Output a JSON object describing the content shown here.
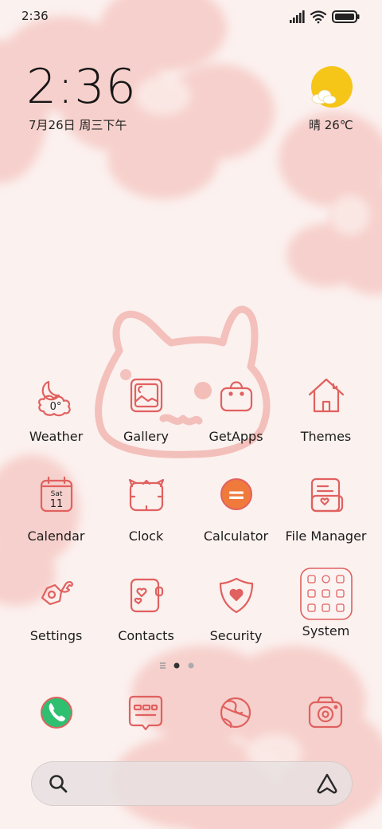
{
  "status_bar": {
    "time": "2:36",
    "icons": [
      "signal-icon",
      "wifi-icon",
      "battery-icon"
    ]
  },
  "clock_widget": {
    "time": "2:36",
    "date": "7月26日 周三下午"
  },
  "weather_widget": {
    "icon": "sun-cloud-icon",
    "text": "晴 26℃"
  },
  "apps": [
    {
      "label": "Weather",
      "icon": "weather-icon",
      "badge": "0°"
    },
    {
      "label": "Gallery",
      "icon": "gallery-icon"
    },
    {
      "label": "GetApps",
      "icon": "shopping-bag-icon"
    },
    {
      "label": "Themes",
      "icon": "home-icon"
    },
    {
      "label": "Calendar",
      "icon": "calendar-icon",
      "day_name": "Sat",
      "day_number": "11"
    },
    {
      "label": "Clock",
      "icon": "clock-icon"
    },
    {
      "label": "Calculator",
      "icon": "calculator-icon",
      "glyph": "="
    },
    {
      "label": "File Manager",
      "icon": "folder-icon"
    },
    {
      "label": "Settings",
      "icon": "wrench-icon"
    },
    {
      "label": "Contacts",
      "icon": "contacts-icon"
    },
    {
      "label": "Security",
      "icon": "shield-icon"
    },
    {
      "label": "System",
      "icon": "folder-grid-icon"
    }
  ],
  "page_indicator": {
    "pages": 2,
    "current": 1
  },
  "dock": [
    {
      "name": "phone",
      "icon": "phone-icon"
    },
    {
      "name": "messages",
      "icon": "message-icon"
    },
    {
      "name": "browser",
      "icon": "browser-icon"
    },
    {
      "name": "camera",
      "icon": "camera-icon"
    }
  ],
  "search": {
    "icon": "search-icon",
    "assistant_icon": "assistant-icon"
  },
  "colors": {
    "accent": "#e0615f",
    "background": "#fbf1ef",
    "blob": "#f5c9c5",
    "sun": "#f5c518",
    "phone_green": "#2fbf71",
    "calculator_orange": "#f07a3c"
  }
}
